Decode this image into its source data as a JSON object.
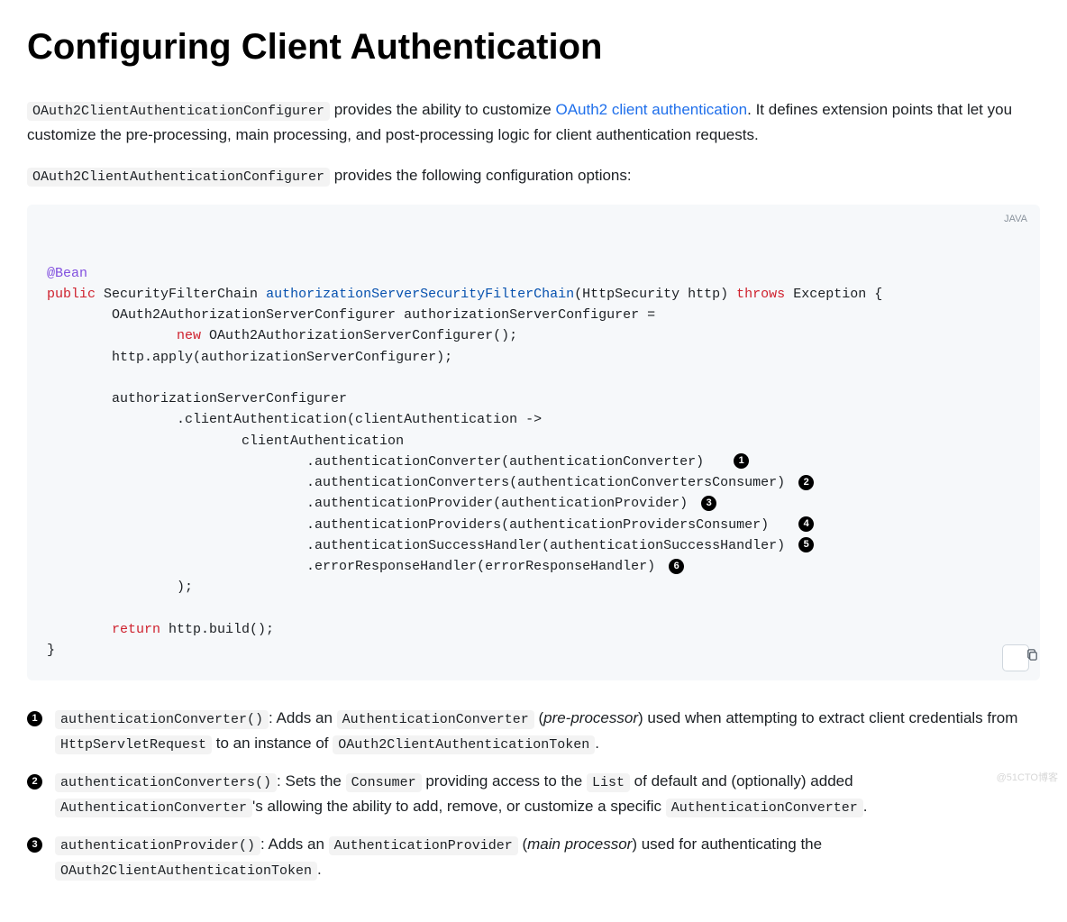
{
  "title": "Configuring Client Authentication",
  "intro": {
    "code1": "OAuth2ClientAuthenticationConfigurer",
    "text1": " provides the ability to customize ",
    "link": "OAuth2 client authentication",
    "text2": ". It defines extension points that let you customize the pre-processing, main processing, and post-processing logic for client authentication requests."
  },
  "intro2": {
    "code": "OAuth2ClientAuthenticationConfigurer",
    "text": " provides the following configuration options:"
  },
  "code": {
    "lang": "JAVA",
    "annotation": "@Bean",
    "kw_public": "public",
    "type1": "SecurityFilterChain",
    "method": "authorizationServerSecurityFilterChain",
    "param": "(HttpSecurity http)",
    "kw_throws": " throws ",
    "exc": "Exception {",
    "l1": "        OAuth2AuthorizationServerConfigurer authorizationServerConfigurer =",
    "l2a": "                ",
    "kw_new": "new",
    "l2b": " OAuth2AuthorizationServerConfigurer();",
    "l3": "        http.apply(authorizationServerConfigurer);",
    "l4": "",
    "l5": "        authorizationServerConfigurer",
    "l6": "                .clientAuthentication(clientAuthentication ->",
    "l7": "                        clientAuthentication",
    "l8": "                                .authenticationConverter(authenticationConverter)   ",
    "l9": "                                .authenticationConverters(authenticationConvertersConsumer) ",
    "l10": "                                .authenticationProvider(authenticationProvider) ",
    "l11": "                                .authenticationProviders(authenticationProvidersConsumer)   ",
    "l12": "                                .authenticationSuccessHandler(authenticationSuccessHandler) ",
    "l13": "                                .errorResponseHandler(errorResponseHandler) ",
    "l14": "                );",
    "l15": "",
    "l16a": "        ",
    "kw_return": "return",
    "l16b": " http.build();",
    "l17": "}"
  },
  "badges": {
    "b1": "1",
    "b2": "2",
    "b3": "3",
    "b4": "4",
    "b5": "5",
    "b6": "6"
  },
  "callouts": [
    {
      "n": "1",
      "c1": "authenticationConverter()",
      "t1": ": Adds an ",
      "c2": "AuthenticationConverter",
      "t2": " (",
      "em": "pre-processor",
      "t3": ") used when attempting to extract client credentials from ",
      "c3": "HttpServletRequest",
      "t4": " to an instance of ",
      "c4": "OAuth2ClientAuthenticationToken",
      "t5": "."
    },
    {
      "n": "2",
      "c1": "authenticationConverters()",
      "t1": ": Sets the ",
      "c2": "Consumer",
      "t2": " providing access to the ",
      "c3": "List",
      "t3": " of default and (optionally) added ",
      "c4": "AuthenticationConverter",
      "t4": "'s allowing the ability to add, remove, or customize a specific ",
      "c5": "AuthenticationConverter",
      "t5": "."
    },
    {
      "n": "3",
      "c1": "authenticationProvider()",
      "t1": ": Adds an ",
      "c2": "AuthenticationProvider",
      "t2": " (",
      "em": "main processor",
      "t3": ") used for authenticating the ",
      "c3": "OAuth2ClientAuthenticationToken",
      "t4": "."
    }
  ],
  "watermark": "@51CTO博客"
}
